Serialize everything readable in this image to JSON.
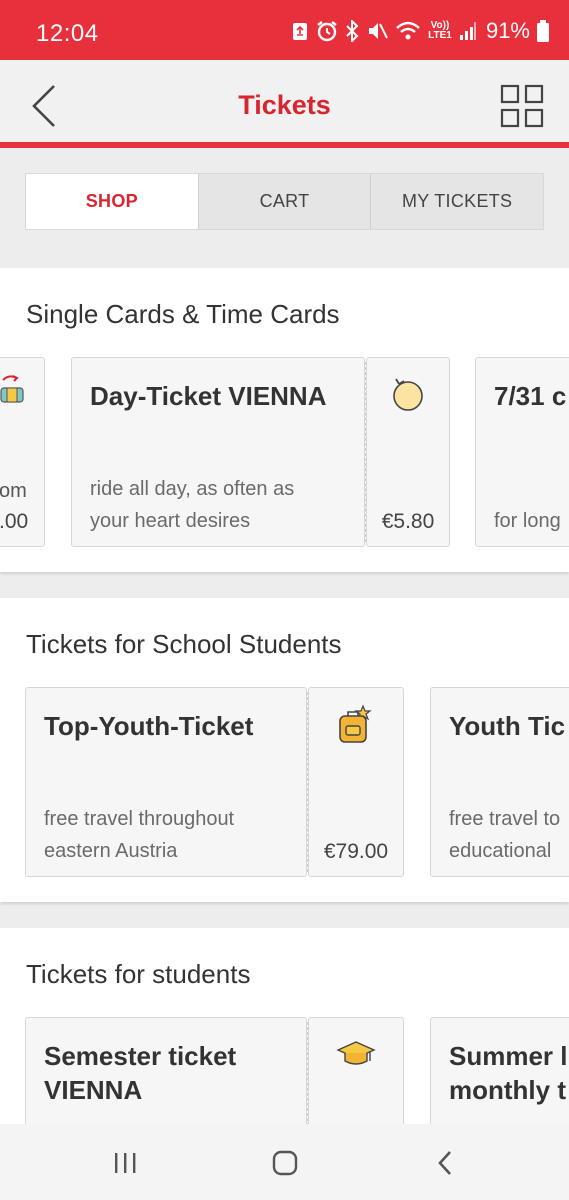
{
  "status_bar": {
    "time": "12:04",
    "volte_label": "Vo)) LTE1",
    "battery_percent": "91%"
  },
  "app_bar": {
    "title": "Tickets",
    "back_icon": "chevron-left-icon",
    "menu_icon": "grid-icon"
  },
  "tabs": [
    {
      "label": "SHOP",
      "active": true
    },
    {
      "label": "CART",
      "active": false
    },
    {
      "label": "MY TICKETS",
      "active": false
    }
  ],
  "sections": [
    {
      "title": "Single Cards & Time Cards",
      "cards": [
        {
          "title": "",
          "desc_partial": "om",
          "price_partial": ".00",
          "icon": "ticket-icon"
        },
        {
          "title": "Day-Ticket VIENNA",
          "desc": [
            "ride all day, as often as",
            "your heart desires"
          ],
          "price": "€5.80",
          "icon": "clock-refresh-icon"
        },
        {
          "title": "7/31 c",
          "desc": [
            "for long"
          ],
          "price": "",
          "icon": ""
        }
      ]
    },
    {
      "title": "Tickets for School Students",
      "cards": [
        {
          "title": "Top-Youth-Ticket",
          "desc": [
            "free travel throughout",
            "eastern Austria"
          ],
          "price": "€79.00",
          "icon": "backpack-icon"
        },
        {
          "title": "Youth Tic",
          "desc": [
            "free travel to",
            "educational"
          ],
          "price": "",
          "icon": ""
        }
      ]
    },
    {
      "title": "Tickets for students",
      "cards": [
        {
          "title": [
            "Semester ticket",
            "VIENNA"
          ],
          "desc": [],
          "price": "",
          "icon": "graduation-cap-icon"
        },
        {
          "title": [
            "Summer l",
            "monthly t"
          ],
          "desc": [],
          "price": "",
          "icon": ""
        }
      ]
    }
  ],
  "nav_bar": {
    "recents_icon": "recents-icon",
    "home_icon": "home-icon",
    "back_icon": "back-icon"
  },
  "colors": {
    "brand_red": "#e8303c",
    "title_red": "#d8252f",
    "icon_yellow": "#f6c945"
  }
}
